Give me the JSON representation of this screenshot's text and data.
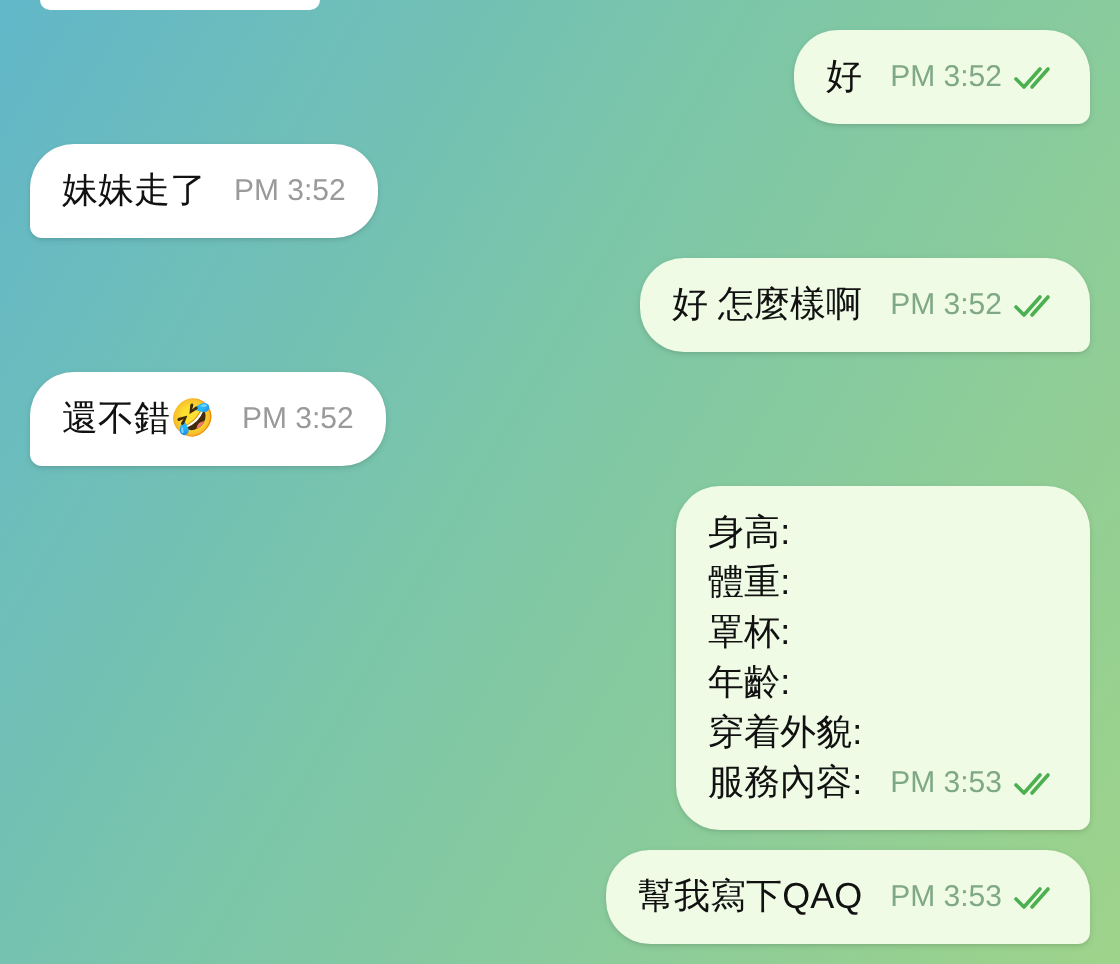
{
  "top_partial_bubble": {
    "kind": "received"
  },
  "messages": [
    {
      "kind": "sent",
      "lines": [
        "好"
      ],
      "time": "PM 3:52",
      "read": true
    },
    {
      "kind": "received",
      "lines": [
        "妹妹走了"
      ],
      "time": "PM 3:52"
    },
    {
      "kind": "sent",
      "lines": [
        "好 怎麼樣啊"
      ],
      "time": "PM 3:52",
      "read": true
    },
    {
      "kind": "received",
      "lines": [
        "還不錯🤣"
      ],
      "time": "PM 3:52"
    },
    {
      "kind": "sent",
      "lines": [
        "身高:",
        "體重:",
        "罩杯:",
        "年齡:",
        "穿着外貌:",
        "服務內容:"
      ],
      "time": "PM 3:53",
      "read": true
    },
    {
      "kind": "sent",
      "lines": [
        "幫我寫下QAQ"
      ],
      "time": "PM 3:53",
      "read": true
    }
  ]
}
